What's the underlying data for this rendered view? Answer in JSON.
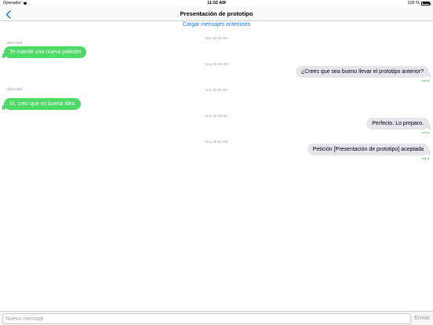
{
  "status_bar": {
    "carrier": "Operador",
    "time": "11:52 AM",
    "battery_percent": "100 %",
    "battery_level": 1.0
  },
  "nav": {
    "title": "Presentación de prototipo",
    "back_icon": "chevron-left-icon"
  },
  "load_earlier": "Cargar mensajes anteriores",
  "colors": {
    "accent": "#1a7ae6",
    "incoming_bubble": "#4cd964",
    "outgoing_bubble": "#e6e5eb",
    "meta_text": "#9b9b9f"
  },
  "conversation": [
    {
      "timestamp": "Hoy 11:48 AM",
      "sender": "Albert Bell",
      "direction": "in",
      "text": "Te mandé una nueva petición",
      "status_dots": false
    },
    {
      "timestamp": "Hoy 11:49 AM",
      "sender": "",
      "direction": "out",
      "text": "¿Crees que sea bueno llevar el prototipo anterior?",
      "status_dots": true
    },
    {
      "timestamp": "Hoy 11:49 AM",
      "sender": "Albert Bell",
      "direction": "in",
      "text": "Sí, creo que es buena idea",
      "status_dots": false
    },
    {
      "timestamp": "Hoy 11:49 AM",
      "sender": "",
      "direction": "out",
      "text": "Perfecto. Lo preparo.",
      "status_dots": true
    },
    {
      "timestamp": "Hoy 11:50 AM",
      "sender": "",
      "direction": "out",
      "text": "Petición  [Presentación de prototipo] aceptada",
      "status_dots": true
    }
  ],
  "input": {
    "placeholder": "Nuevo mensaje",
    "value": "",
    "send_label": "Enviar"
  }
}
